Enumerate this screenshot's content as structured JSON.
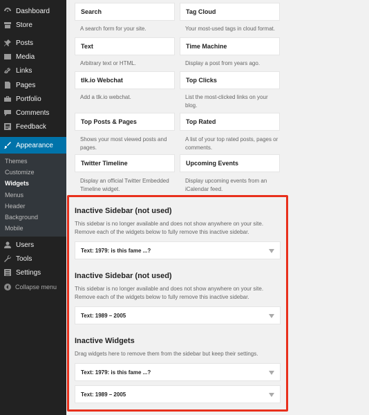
{
  "sidebar": {
    "items": [
      {
        "label": "Dashboard",
        "icon": "dashboard-icon"
      },
      {
        "label": "Store",
        "icon": "store-icon"
      },
      {
        "label": "Posts",
        "icon": "pin-icon"
      },
      {
        "label": "Media",
        "icon": "media-icon"
      },
      {
        "label": "Links",
        "icon": "link-icon"
      },
      {
        "label": "Pages",
        "icon": "page-icon"
      },
      {
        "label": "Portfolio",
        "icon": "portfolio-icon"
      },
      {
        "label": "Comments",
        "icon": "comment-icon"
      },
      {
        "label": "Feedback",
        "icon": "feedback-icon"
      },
      {
        "label": "Appearance",
        "icon": "brush-icon"
      },
      {
        "label": "Users",
        "icon": "user-icon"
      },
      {
        "label": "Tools",
        "icon": "wrench-icon"
      },
      {
        "label": "Settings",
        "icon": "settings-icon"
      }
    ],
    "submenu": [
      "Themes",
      "Customize",
      "Widgets",
      "Menus",
      "Header",
      "Background",
      "Mobile"
    ],
    "collapse_label": "Collapse menu"
  },
  "widgets": [
    {
      "title": "Search",
      "desc": "A search form for your site."
    },
    {
      "title": "Tag Cloud",
      "desc": "Your most-used tags in cloud format."
    },
    {
      "title": "Text",
      "desc": "Arbitrary text or HTML."
    },
    {
      "title": "Time Machine",
      "desc": "Display a post from years ago."
    },
    {
      "title": "tlk.io Webchat",
      "desc": "Add a tlk.io webchat."
    },
    {
      "title": "Top Clicks",
      "desc": "List the most-clicked links on your blog."
    },
    {
      "title": "Top Posts & Pages",
      "desc": "Shows your most viewed posts and pages."
    },
    {
      "title": "Top Rated",
      "desc": "A list of your top rated posts, pages or comments."
    },
    {
      "title": "Twitter Timeline",
      "desc": "Display an official Twitter Embedded Timeline widget."
    },
    {
      "title": "Upcoming Events",
      "desc": "Display upcoming events from an iCalendar feed."
    }
  ],
  "inactive": {
    "sidebar1": {
      "title": "Inactive Sidebar (not used)",
      "desc": "This sidebar is no longer available and does not show anywhere on your site. Remove each of the widgets below to fully remove this inactive sidebar.",
      "widget": "Text: 1979: is this fame ...?"
    },
    "sidebar2": {
      "title": "Inactive Sidebar (not used)",
      "desc": "This sidebar is no longer available and does not show anywhere on your site. Remove each of the widgets below to fully remove this inactive sidebar.",
      "widget": "Text: 1989 – 2005"
    },
    "widgets_section": {
      "title": "Inactive Widgets",
      "desc": "Drag widgets here to remove them from the sidebar but keep their settings.",
      "items": [
        "Text: 1979: is this fame ...?",
        "Text: 1989 – 2005"
      ]
    }
  },
  "colors": {
    "sidebar_bg": "#222222",
    "active_blue": "#0073aa",
    "highlight_red": "#e8301c"
  }
}
